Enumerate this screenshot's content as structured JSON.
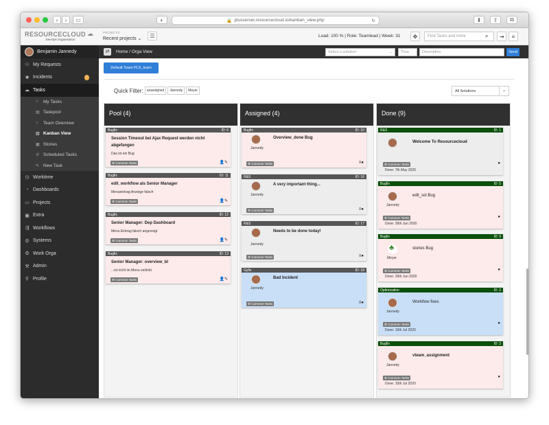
{
  "browser": {
    "url": "plusserver.resourcecloud.io/kanban_view.php"
  },
  "app": {
    "logo": "RESOURCECLOUD",
    "logo_sub": "DevOps Organisation",
    "projects_label": "PROJECTS:",
    "projects_value": "Recent projects",
    "load_text": "Load: 100 % | Role: Teamlead | Week: 31",
    "search_placeholder": "Find Tasks and more"
  },
  "sidebar": {
    "user": "Benjamin Jannedy",
    "items": [
      {
        "icon": "users-icon",
        "label": "My Requests"
      },
      {
        "icon": "bug-icon",
        "label": "Incidents",
        "badge": "!"
      },
      {
        "icon": "cloud-icon",
        "label": "Tasks"
      },
      {
        "icon": "clock-icon",
        "label": "Worktime"
      },
      {
        "icon": "dashboard-icon",
        "label": "Dashboards"
      },
      {
        "icon": "folder-icon",
        "label": "Projects"
      },
      {
        "icon": "box-icon",
        "label": "Extra"
      },
      {
        "icon": "workflow-icon",
        "label": "Workflows"
      },
      {
        "icon": "systems-icon",
        "label": "Systems"
      },
      {
        "icon": "gears-icon",
        "label": "Work Orga"
      },
      {
        "icon": "wrench-icon",
        "label": "Admin"
      },
      {
        "icon": "user-icon",
        "label": "Profile"
      }
    ],
    "tasks_sub": [
      "My Tasks",
      "Taskpool",
      "Team Overview",
      "Kanban View",
      "Stories",
      "Scheduled Tasks",
      "New Task"
    ]
  },
  "breadcrumb": {
    "text": "Home / Orga View",
    "solution_placeholder": "Select a solution!",
    "time_placeholder": "Time",
    "desc_placeholder": "Description",
    "send": "Send"
  },
  "toolbar": {
    "team_button": "Default Team PLS_team",
    "quick_filter": "Quick Filter:",
    "chips": [
      "unassigned",
      "Jannedy",
      "Meyer"
    ],
    "all_solutions": "All Solutions"
  },
  "columns": [
    {
      "title": "Pool (4)",
      "cards": [
        {
          "type": "Bugfix",
          "id": "ID: 6",
          "title": "Session Timeout bei Ajax Request werden nicht abgefangen",
          "desc": "Das ist ein Bug",
          "tag": "Common Tasks"
        },
        {
          "type": "Bugfix",
          "id": "ID: 11",
          "title": "edit_workflow als Senior Manager",
          "desc": "Menueintrag Anzeige falsch",
          "tag": "Common Tasks"
        },
        {
          "type": "Bugfix",
          "id": "ID: 12",
          "title": "Senior Manager: Dep Dashboard",
          "desc": "Menu Eintrag falsch angezeigt",
          "tag": "Common Tasks"
        },
        {
          "type": "Bugfix",
          "id": "ID: 13",
          "title": "Senior Manager: overview_bl",
          "desc": "...ist nicht im Menu verlinkt",
          "tag": "Common Tasks"
        }
      ]
    },
    {
      "title": "Assigned (4)",
      "cards": [
        {
          "type": "Bugfix",
          "id": "ID: 10",
          "title": "Overview_done Bug",
          "name": "Jannedy",
          "tag": "Common Tasks"
        },
        {
          "type": "R&S",
          "id": "ID: 16",
          "title": "A very important thing...",
          "name": "Jannedy",
          "tag": "Common Tasks"
        },
        {
          "type": "R&S",
          "id": "ID: 17",
          "title": "Needs to be done today!",
          "name": "Jannedy",
          "tag": "Common Tasks"
        },
        {
          "type": "Gyfix",
          "id": "ID: 18",
          "title": "Bad Incident",
          "name": "Jannedy",
          "tag": "Common Tasks"
        }
      ]
    },
    {
      "title": "Done (9)",
      "cards": [
        {
          "type": "R&S",
          "id": "ID: 1",
          "title": "Welcome To Resourcecloud",
          "name": "",
          "tag": "Common Tasks",
          "done": "Done: 7th May 2020"
        },
        {
          "type": "Bugfix",
          "id": "ID: 5",
          "title": "edit_sol Bug",
          "name": "Jannedy",
          "tag": "Common Tasks",
          "done": "Done: 26th Jun 2020"
        },
        {
          "type": "Bugfix",
          "id": "ID: 9",
          "title": "stories Bug",
          "name": "Meyer",
          "tag": "Common Tasks",
          "done": "Done: 26th Jun 2020"
        },
        {
          "type": "Optimization",
          "id": "ID: 2",
          "title": "Workflow fixes",
          "name": "Jannedy",
          "tag": "Common Tasks",
          "done": "Done: 10th Jul 2020"
        },
        {
          "type": "Bugfix",
          "id": "ID: 3",
          "title": "vteam_assignment",
          "name": "Jannedy",
          "tag": "Common Tasks",
          "done": "Done: 10th Jul 2020"
        }
      ]
    }
  ]
}
